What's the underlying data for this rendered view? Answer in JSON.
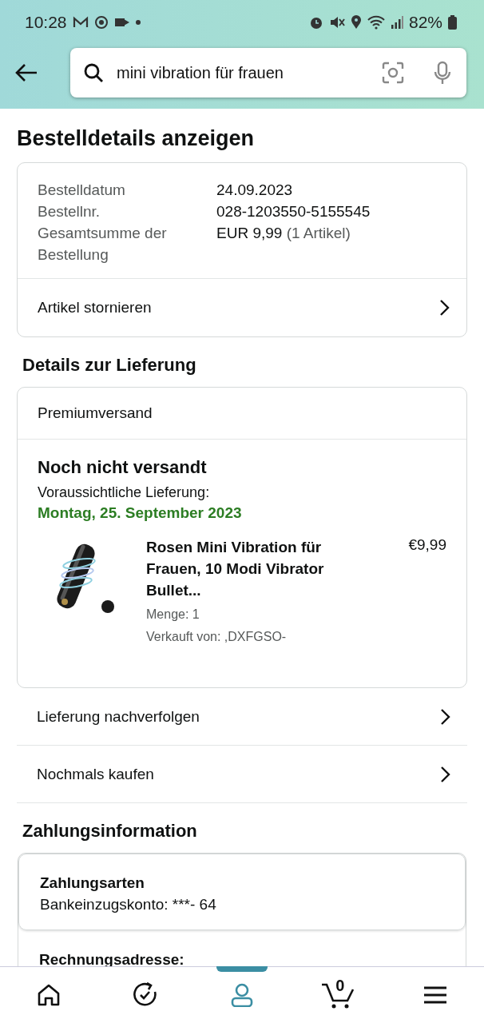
{
  "status_bar": {
    "time": "10:28",
    "battery": "82%"
  },
  "search": {
    "value": "mini vibration für frauen"
  },
  "title": "Bestelldetails anzeigen",
  "order_summary": {
    "rows": [
      {
        "label": "Bestelldatum",
        "value": "24.09.2023",
        "note": ""
      },
      {
        "label": "Bestellnr.",
        "value": "028-1203550-5155545",
        "note": ""
      },
      {
        "label": "Gesamtsumme der Bestellung",
        "value": "EUR 9,99",
        "note": "(1 Artikel)"
      }
    ],
    "action": "Artikel stornieren"
  },
  "delivery": {
    "heading": "Details zur Lieferung",
    "shipping": "Premiumversand",
    "status": "Noch nicht versandt",
    "eta_label": "Voraussichtliche Lieferung:",
    "eta_date": "Montag, 25. September 2023",
    "item": {
      "kind": "picture",
      "title": "Rosen Mini Vibration für Frauen, 10 Modi Vibrator Bullet...",
      "price": "€9,99",
      "quantity": "Menge: 1",
      "seller": "Verkauft von: ,DXFGSO-"
    }
  },
  "delivery_actions": [
    "Lieferung nachverfolgen",
    "Nochmals kaufen"
  ],
  "payment": {
    "heading": "Zahlungsinformation",
    "method_label": "Zahlungsarten",
    "method_value": "Bankeinzugskonto: ***- 64",
    "billing_label": "Rechnungsadresse:"
  },
  "bottom_nav": [
    {
      "kind": "home",
      "selected": false
    },
    {
      "kind": "orders",
      "selected": false
    },
    {
      "kind": "account",
      "selected": true
    },
    {
      "kind": "cart",
      "selected": false,
      "count": "0"
    },
    {
      "kind": "menu",
      "selected": false
    }
  ]
}
